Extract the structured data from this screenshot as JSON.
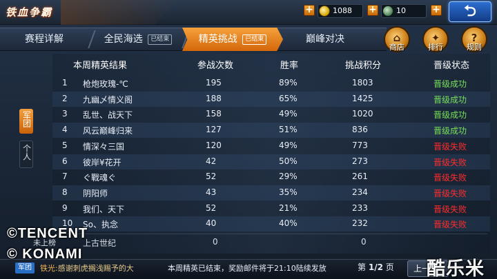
{
  "app": {
    "title": "铁血争霸"
  },
  "currency": {
    "gold": "1088",
    "honor": "10"
  },
  "tabs": [
    {
      "label": "赛程详解",
      "badge": ""
    },
    {
      "label": "全民海选",
      "badge": "已结束"
    },
    {
      "label": "精英挑战",
      "badge": "已结束"
    },
    {
      "label": "巅峰对决",
      "badge": ""
    }
  ],
  "side_buttons": {
    "shop": "商店",
    "rank": "排行",
    "rules": "规则"
  },
  "left_tabs": {
    "army": "军团",
    "personal": "个人"
  },
  "table": {
    "headers": [
      "本周精英结果",
      "参战次数",
      "胜率",
      "挑战积分",
      "晋级状态"
    ],
    "rows": [
      {
        "rank": "1",
        "name": "枪炮玫瑰-℃",
        "battles": "195",
        "win_rate": "89%",
        "score": "1803",
        "status": "晋级成功",
        "promoted": true
      },
      {
        "rank": "2",
        "name": "九幽乄情义阁",
        "battles": "188",
        "win_rate": "65%",
        "score": "1425",
        "status": "晋级成功",
        "promoted": true
      },
      {
        "rank": "3",
        "name": "乱世、战天下",
        "battles": "158",
        "win_rate": "49%",
        "score": "1020",
        "status": "晋级成功",
        "promoted": true
      },
      {
        "rank": "4",
        "name": "风云巅峰归来",
        "battles": "127",
        "win_rate": "51%",
        "score": "836",
        "status": "晋级成功",
        "promoted": true
      },
      {
        "rank": "5",
        "name": "情深々三国",
        "battles": "120",
        "win_rate": "49%",
        "score": "773",
        "status": "晋级失败",
        "promoted": false
      },
      {
        "rank": "6",
        "name": "彼岸¥花开",
        "battles": "42",
        "win_rate": "50%",
        "score": "273",
        "status": "晋级失败",
        "promoted": false
      },
      {
        "rank": "7",
        "name": "ぐ戰魂ぐ",
        "battles": "52",
        "win_rate": "29%",
        "score": "261",
        "status": "晋级失败",
        "promoted": false
      },
      {
        "rank": "8",
        "name": "阴阳师",
        "battles": "43",
        "win_rate": "35%",
        "score": "234",
        "status": "晋级失败",
        "promoted": false
      },
      {
        "rank": "9",
        "name": "我们、天下",
        "battles": "52",
        "win_rate": "21%",
        "score": "233",
        "status": "晋级失败",
        "promoted": false
      },
      {
        "rank": "10",
        "name": "So、执念",
        "battles": "40",
        "win_rate": "40%",
        "score": "232",
        "status": "晋级失败",
        "promoted": false
      }
    ],
    "self_row": {
      "rank": "未上榜",
      "name": "上古世纪",
      "battles": "0",
      "score": "0"
    }
  },
  "bottom": {
    "channel": "军团",
    "chat_sender": "铁光:",
    "chat_text": "感谢刺虎搁浅赐予的大",
    "notice": "本周精英已结束，奖励邮件将于21:10陆续发放",
    "page_prefix": "第",
    "page_value": "1/2",
    "page_suffix": "页",
    "prev_label": "上一页"
  },
  "watermarks": {
    "tencent": "©TENCENT",
    "konami": "© KONAMI",
    "site": "酷乐米"
  },
  "colors": {
    "promoted": "#79e05a",
    "failed": "#ff2d2d",
    "active_tab": "#e8821e",
    "back_button": "#2160b8"
  },
  "icons": {
    "back": "back-arrow-icon",
    "shop": "shop-icon",
    "rank": "wings-icon",
    "rules": "question-icon"
  }
}
